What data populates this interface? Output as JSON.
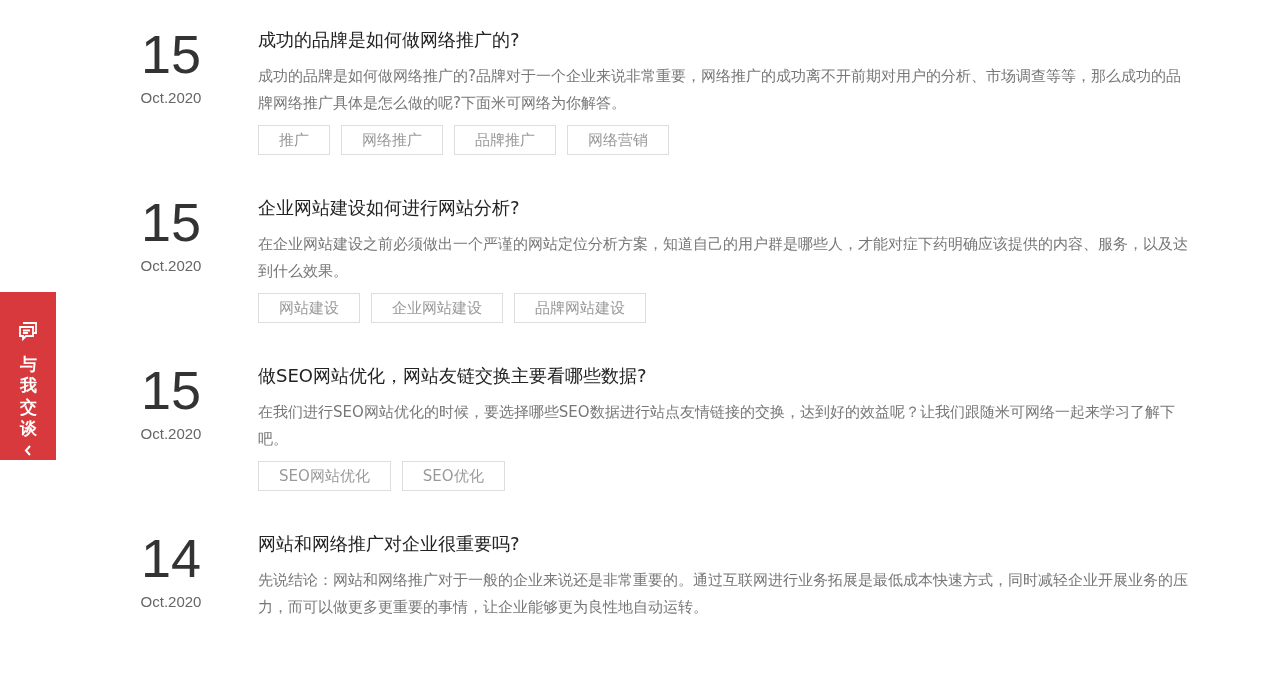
{
  "side_tab": {
    "label": "与我交谈"
  },
  "articles": [
    {
      "day": "15",
      "month": "Oct.2020",
      "title": "成功的品牌是如何做网络推广的?",
      "summary": "成功的品牌是如何做网络推广的?品牌对于一个企业来说非常重要，网络推广的成功离不开前期对用户的分析、市场调查等等，那么成功的品牌网络推广具体是怎么做的呢?下面米可网络为你解答。",
      "tags": [
        "推广",
        "网络推广",
        "品牌推广",
        "网络营销"
      ]
    },
    {
      "day": "15",
      "month": "Oct.2020",
      "title": "企业网站建设如何进行网站分析?",
      "summary": "在企业网站建设之前必须做出一个严谨的网站定位分析方案，知道自己的用户群是哪些人，才能对症下药明确应该提供的内容、服务，以及达到什么效果。",
      "tags": [
        "网站建设",
        "企业网站建设",
        "品牌网站建设"
      ]
    },
    {
      "day": "15",
      "month": "Oct.2020",
      "title": "做SEO网站优化，网站友链交换主要看哪些数据?",
      "summary": "在我们进行SEO网站优化的时候，要选择哪些SEO数据进行站点友情链接的交换，达到好的效益呢？让我们跟随米可网络一起来学习了解下吧。",
      "tags": [
        "SEO网站优化",
        "SEO优化"
      ]
    },
    {
      "day": "14",
      "month": "Oct.2020",
      "title": "网站和网络推广对企业很重要吗?",
      "summary": "先说结论：网站和网络推广对于一般的企业来说还是非常重要的。通过互联网进行业务拓展是最低成本快速方式，同时减轻企业开展业务的压力，而可以做更多更重要的事情，让企业能够更为良性地自动运转。"
    }
  ]
}
